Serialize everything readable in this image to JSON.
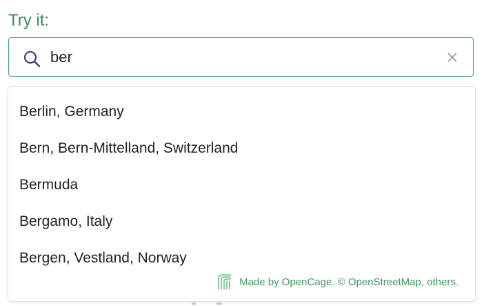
{
  "heading": "Try it:",
  "search": {
    "value": "ber",
    "icon": "search-icon",
    "clear_icon": "close-icon"
  },
  "suggestions": [
    "Berlin, Germany",
    "Bern, Bern-Mittelland, Switzerland",
    "Bermuda",
    "Bergamo, Italy",
    "Bergen, Vestland, Norway"
  ],
  "footer": {
    "logo_icon": "opencage-logo-icon",
    "credit": "Made by OpenCage. © OpenStreetMap, others."
  },
  "colors": {
    "accent": "#3b8a5a",
    "border": "#46a06a",
    "text": "#222222",
    "icon": "#3a3f8f"
  }
}
